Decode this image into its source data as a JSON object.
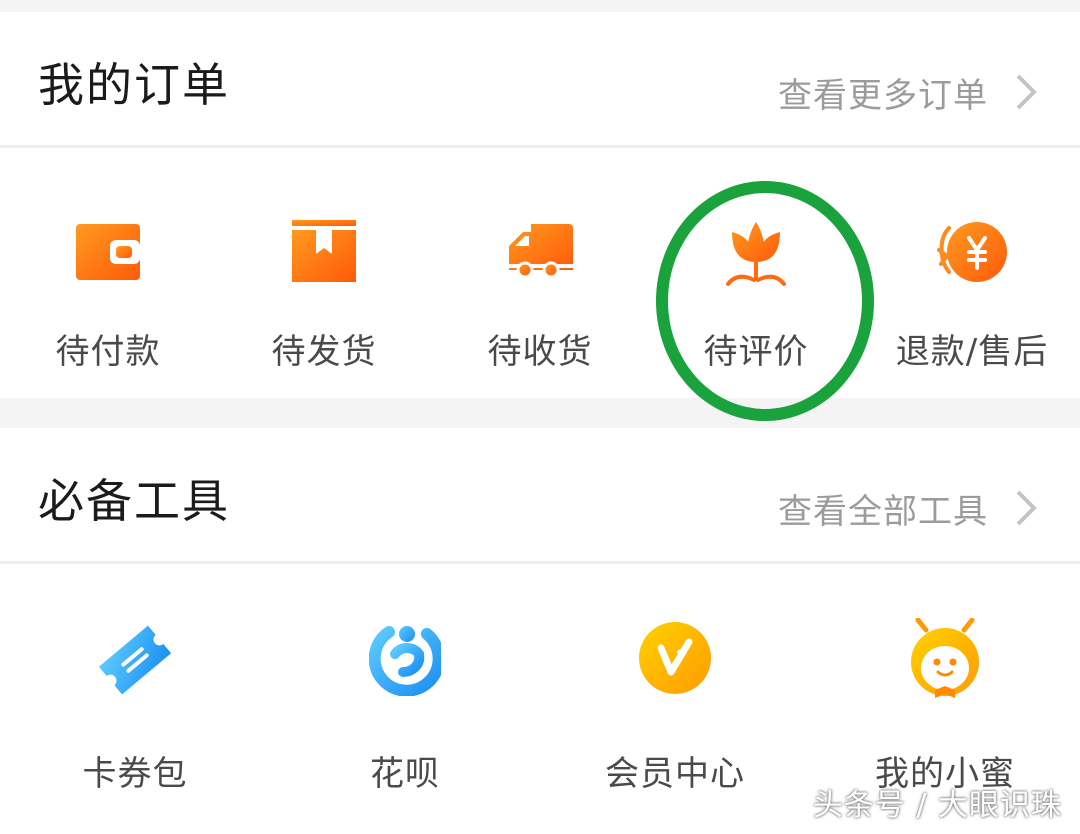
{
  "orders": {
    "title": "我的订单",
    "more_label": "查看更多订单",
    "items": [
      {
        "label": "待付款",
        "icon": "wallet-icon"
      },
      {
        "label": "待发货",
        "icon": "package-icon"
      },
      {
        "label": "待收货",
        "icon": "truck-icon"
      },
      {
        "label": "待评价",
        "icon": "flower-icon"
      },
      {
        "label": "退款/售后",
        "icon": "refund-yuan-icon"
      }
    ],
    "highlighted_item": "待评价"
  },
  "tools": {
    "title": "必备工具",
    "more_label": "查看全部工具",
    "items": [
      {
        "label": "卡券包",
        "icon": "ticket-icon"
      },
      {
        "label": "花呗",
        "icon": "huabei-icon"
      },
      {
        "label": "会员中心",
        "icon": "vip-icon"
      },
      {
        "label": "我的小蜜",
        "icon": "bee-mascot-icon"
      }
    ]
  },
  "watermark": "头条号 / 大眼识珠",
  "colors": {
    "accent_orange": "#ff6a12",
    "accent_orange_light": "#ff8a1e",
    "blue": "#2ca7f5",
    "gold": "#ffb400",
    "highlight_green": "#1aa23c",
    "title_text": "#1b1b1b",
    "muted_text": "#9b9b9b",
    "label_text": "#4a4a4a"
  }
}
